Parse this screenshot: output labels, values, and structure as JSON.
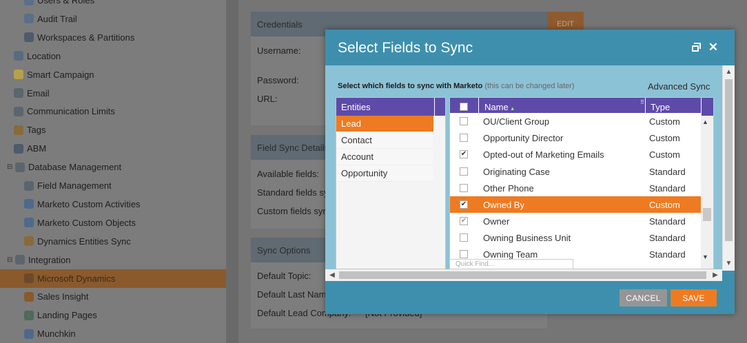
{
  "sidebar": {
    "items": [
      {
        "label": "Users & Roles",
        "icon": "users-icon",
        "indent": 2
      },
      {
        "label": "Audit Trail",
        "icon": "audit-trail-icon",
        "indent": 2
      },
      {
        "label": "Workspaces & Partitions",
        "icon": "globe-icon",
        "indent": 2
      },
      {
        "label": "Location",
        "icon": "location-icon",
        "indent": 1
      },
      {
        "label": "Smart Campaign",
        "icon": "lightbulb-icon",
        "indent": 1
      },
      {
        "label": "Email",
        "icon": "email-icon",
        "indent": 1
      },
      {
        "label": "Communication Limits",
        "icon": "at-icon",
        "indent": 1
      },
      {
        "label": "Tags",
        "icon": "tag-icon",
        "indent": 1
      },
      {
        "label": "ABM",
        "icon": "abm-icon",
        "indent": 1
      },
      {
        "label": "Database Management",
        "icon": "database-icon",
        "indent": 1,
        "toggle": "⊟"
      },
      {
        "label": "Field Management",
        "icon": "field-management-icon",
        "indent": 2
      },
      {
        "label": "Marketo Custom Activities",
        "icon": "custom-activities-icon",
        "indent": 2
      },
      {
        "label": "Marketo Custom Objects",
        "icon": "custom-objects-icon",
        "indent": 2
      },
      {
        "label": "Dynamics Entities Sync",
        "icon": "sync-icon",
        "indent": 2
      },
      {
        "label": "Integration",
        "icon": "cloud-icon",
        "indent": 1,
        "toggle": "⊟"
      },
      {
        "label": "Microsoft Dynamics",
        "icon": "dynamics-icon",
        "indent": 2,
        "active": true
      },
      {
        "label": "Sales Insight",
        "icon": "sales-insight-icon",
        "indent": 2
      },
      {
        "label": "Landing Pages",
        "icon": "landing-pages-icon",
        "indent": 2
      },
      {
        "label": "Munchkin",
        "icon": "munchkin-icon",
        "indent": 2
      }
    ]
  },
  "credentials": {
    "title": "Credentials",
    "edit_label": "EDIT",
    "username_label": "Username:",
    "password_label": "Password:",
    "url_label": "URL:"
  },
  "field_sync": {
    "title": "Field Sync Details",
    "available": "Available fields:",
    "standard": "Standard fields sync",
    "custom": "Custom fields sync"
  },
  "sync_options": {
    "title": "Sync Options",
    "default_topic": "Default Topic:",
    "default_last_name": "Default Last Name:",
    "default_lead_company": "Default Lead Company:",
    "default_lead_company_value": "[Not Provided]"
  },
  "modal": {
    "title": "Select Fields to Sync",
    "instruction": "Select which fields to sync with Marketo",
    "instruction_note": "(this can be changed later)",
    "advanced_sync": "Advanced Sync",
    "entities_header": "Entities",
    "entities": [
      {
        "label": "Lead",
        "selected": true
      },
      {
        "label": "Contact",
        "selected": false
      },
      {
        "label": "Account",
        "selected": false
      },
      {
        "label": "Opportunity",
        "selected": false
      }
    ],
    "fields_header": {
      "name": "Name",
      "type": "Type"
    },
    "fields": [
      {
        "name": "OU/Client Group",
        "type": "Custom",
        "checked": false
      },
      {
        "name": "Opportunity Director",
        "type": "Custom",
        "checked": false
      },
      {
        "name": "Opted-out of Marketing Emails",
        "type": "Custom",
        "checked": true
      },
      {
        "name": "Originating Case",
        "type": "Standard",
        "checked": false
      },
      {
        "name": "Other Phone",
        "type": "Standard",
        "checked": false
      },
      {
        "name": "Owned By",
        "type": "Custom",
        "checked": true,
        "selected": true
      },
      {
        "name": "Owner",
        "type": "Standard",
        "checked": true,
        "soft": true
      },
      {
        "name": "Owning Business Unit",
        "type": "Standard",
        "checked": false
      },
      {
        "name": "Owning Team",
        "type": "Standard",
        "checked": false
      }
    ],
    "quick_find_placeholder": "Quick Find...",
    "cancel_label": "CANCEL",
    "save_label": "SAVE"
  },
  "colors": {
    "modal_bg": "#3e8fae",
    "body_bg": "#8cc2d6",
    "grid_header": "#5e4aa8",
    "accent": "#ee7b22",
    "cancel": "#959595"
  }
}
